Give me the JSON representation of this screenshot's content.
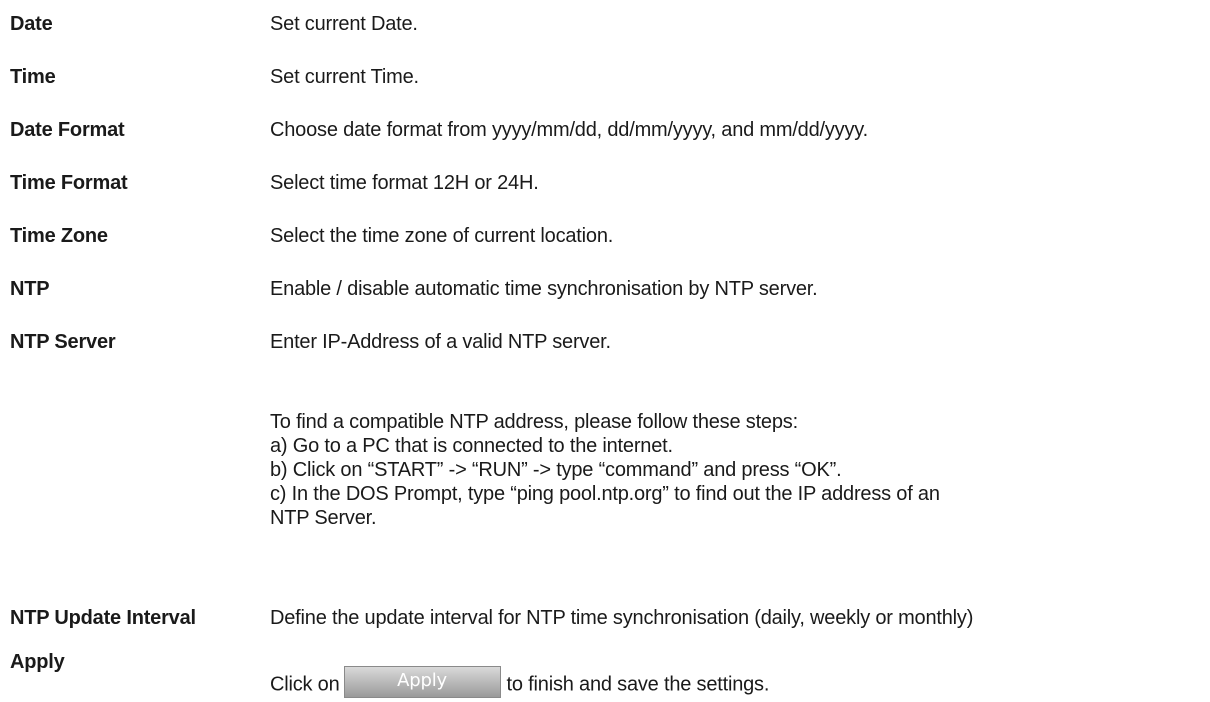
{
  "rows": [
    {
      "term": "Date",
      "desc": "Set current Date."
    },
    {
      "term": "Time",
      "desc": "Set current Time."
    },
    {
      "term": "Date Format",
      "desc": "Choose date format from yyyy/mm/dd, dd/mm/yyyy, and mm/dd/yyyy."
    },
    {
      "term": "Time Format",
      "desc": "Select time format 12H or 24H."
    },
    {
      "term": "Time Zone",
      "desc": "Select the time zone of current location."
    },
    {
      "term": "NTP",
      "desc": "Enable / disable automatic time synchronisation by NTP server."
    },
    {
      "term": "NTP Server",
      "desc": "Enter IP-Address of a valid NTP server."
    }
  ],
  "ntp_steps": {
    "intro": "To find a compatible NTP address, please follow these steps:",
    "a": "a) Go to a PC that is connected to the internet.",
    "b": "b) Click on “START” -> “RUN” -> type “command” and press “OK”.",
    "c1": "c) In the DOS Prompt, type “ping pool.ntp.org” to find out the IP address of an",
    "c2": "NTP Server."
  },
  "update_interval": {
    "term": "NTP Update Interval",
    "desc": "Define the update interval for NTP time synchronisation (daily, weekly or monthly)"
  },
  "apply": {
    "term": "Apply",
    "prefix": "Click on",
    "button_label": "Apply",
    "suffix": "to finish and save the settings."
  }
}
